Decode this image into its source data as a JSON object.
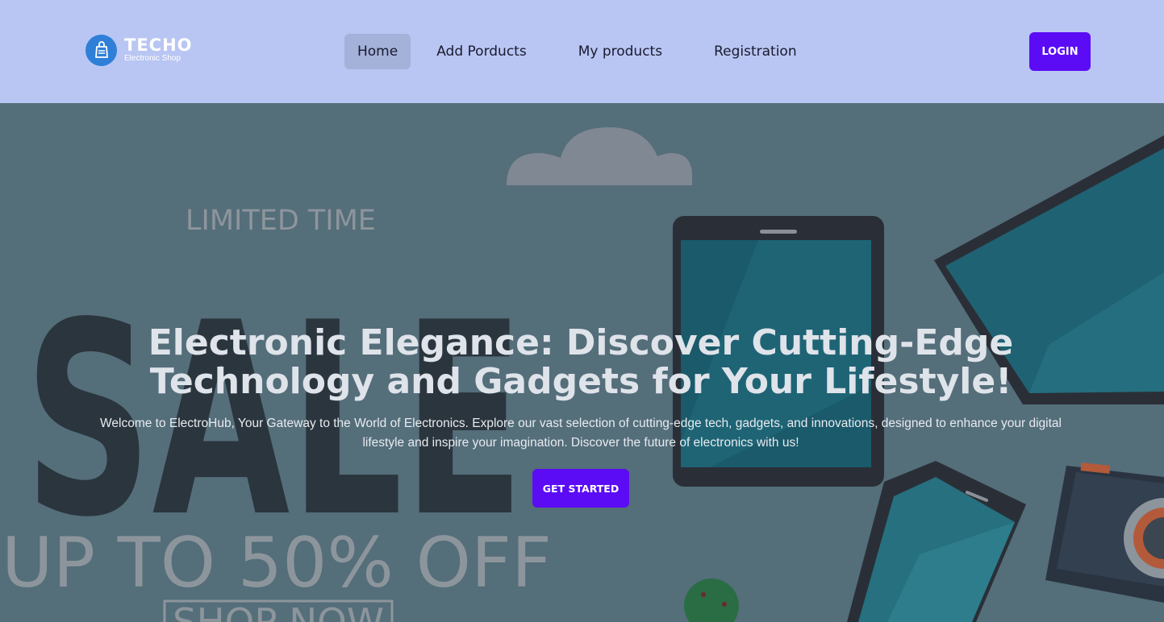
{
  "brand": {
    "name": "TECHO",
    "subtitle": "Electronic Shop",
    "icon": "shopping-bag-icon"
  },
  "nav": {
    "items": [
      {
        "label": "Home",
        "active": true
      },
      {
        "label": "Add Porducts",
        "active": false
      },
      {
        "label": "My products",
        "active": false
      },
      {
        "label": "Registration",
        "active": false
      }
    ],
    "login_label": "LOGIN"
  },
  "hero": {
    "background_banner": {
      "limited_time": "LIMITED TIME",
      "sale": "SALE",
      "offer": "UP TO 50% OFF",
      "shop_now": "SHOP NOW"
    },
    "title": "Electronic Elegance: Discover Cutting-Edge Technology and Gadgets for Your Lifestyle!",
    "description": "Welcome to ElectroHub, Your Gateway to the World of Electronics. Explore our vast selection of cutting-edge tech, gadgets, and innovations, designed to enhance your digital lifestyle and inspire your imagination. Discover the future of electronics with us!",
    "cta_label": "GET STARTED"
  },
  "colors": {
    "navbar_bg": "#b9c6f3",
    "accent": "#5b0cf5",
    "hero_overlay": "#546e7a",
    "brand_icon": "#2f7fd8"
  }
}
